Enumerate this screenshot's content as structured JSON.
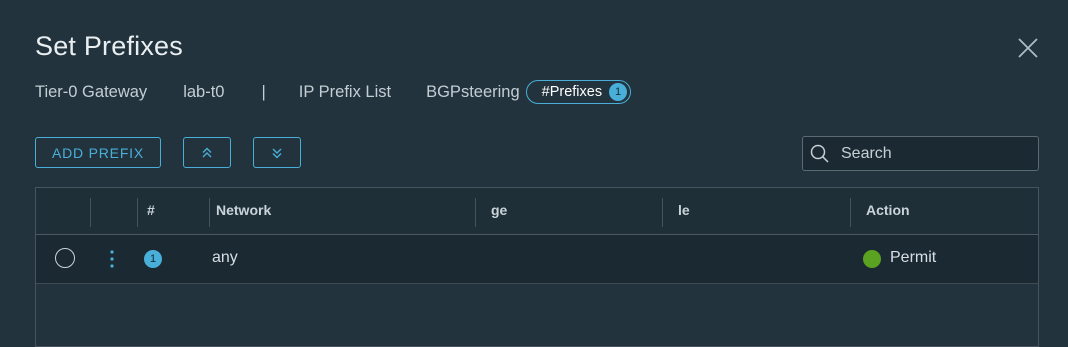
{
  "dialog": {
    "title": "Set Prefixes"
  },
  "breadcrumb": {
    "gateway_label": "Tier-0 Gateway",
    "gateway_value": "lab-t0",
    "separator": "|",
    "list_label": "IP Prefix List",
    "list_value": "BGPsteering",
    "pill_label": "#Prefixes",
    "pill_count": "1"
  },
  "toolbar": {
    "add_label": "ADD PREFIX",
    "move_up_icon": "chevrons-up-icon",
    "move_down_icon": "chevrons-down-icon"
  },
  "search": {
    "placeholder": "Search",
    "value": ""
  },
  "table": {
    "columns": [
      "#",
      "Network",
      "ge",
      "le",
      "Action"
    ],
    "rows": [
      {
        "index": "1",
        "network": "any",
        "ge": "",
        "le": "",
        "action": "Permit",
        "action_color": "#5aa220"
      }
    ]
  },
  "colors": {
    "accent": "#49afd9",
    "background": "#22333d",
    "permit": "#5aa220"
  }
}
